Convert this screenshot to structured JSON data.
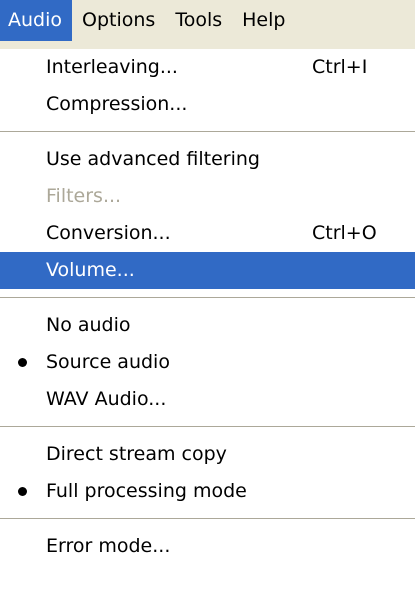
{
  "menubar": {
    "items": [
      {
        "label": "Audio",
        "active": true
      },
      {
        "label": "Options"
      },
      {
        "label": "Tools"
      },
      {
        "label": "Help"
      }
    ]
  },
  "menu": {
    "interleaving": {
      "label": "Interleaving...",
      "shortcut": "Ctrl+I"
    },
    "compression": {
      "label": "Compression..."
    },
    "advanced_filtering": {
      "label": "Use advanced filtering"
    },
    "filters": {
      "label": "Filters...",
      "disabled": true
    },
    "conversion": {
      "label": "Conversion...",
      "shortcut": "Ctrl+O"
    },
    "volume": {
      "label": "Volume...",
      "highlighted": true
    },
    "no_audio": {
      "label": "No audio"
    },
    "source_audio": {
      "label": "Source audio",
      "checked": true
    },
    "wav_audio": {
      "label": "WAV Audio..."
    },
    "direct_stream_copy": {
      "label": "Direct stream copy"
    },
    "full_processing_mode": {
      "label": "Full processing mode",
      "checked": true
    },
    "error_mode": {
      "label": "Error mode..."
    }
  },
  "colors": {
    "highlight": "#316ac5",
    "menubar_background": "#ece9d8",
    "disabled_text": "#aca899",
    "separator": "#aca899"
  },
  "icons": {
    "radio_bullet": "bullet-icon"
  }
}
